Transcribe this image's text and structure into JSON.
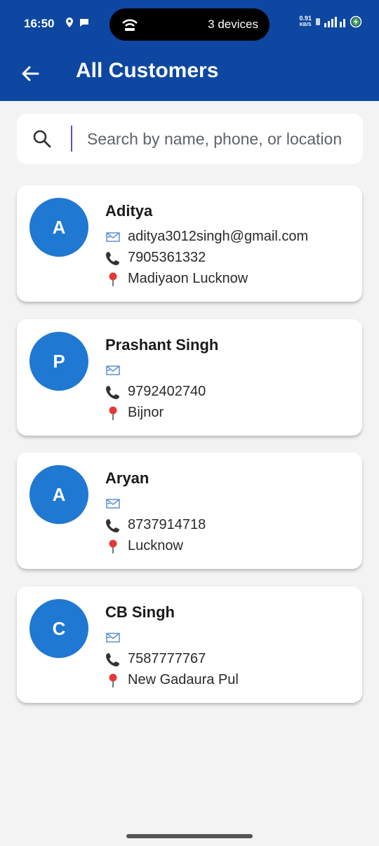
{
  "status_bar": {
    "time": "16:50",
    "pill_text": "3 devices",
    "net_speed_value": "0.91",
    "net_speed_unit": "KB/S",
    "bg_color": "#0d47a1"
  },
  "app_bar": {
    "title": "All Customers",
    "back_icon": "arrow-back-icon"
  },
  "search": {
    "placeholder": "Search by name, phone, or location",
    "value": "",
    "icon": "search-icon"
  },
  "customers": [
    {
      "initial": "A",
      "name": "Aditya",
      "email": "aditya3012singh@gmail.com",
      "phone": "7905361332",
      "location": "Madiyaon Lucknow"
    },
    {
      "initial": "P",
      "name": "Prashant Singh",
      "email": "",
      "phone": "9792402740",
      "location": "Bijnor"
    },
    {
      "initial": "A",
      "name": "Aryan",
      "email": "",
      "phone": "8737914718",
      "location": "Lucknow"
    },
    {
      "initial": "C",
      "name": "CB Singh",
      "email": "",
      "phone": "7587777767",
      "location": "New Gadaura Pul"
    }
  ],
  "colors": {
    "app_bar": "#0d47a1",
    "avatar": "#1f78d1",
    "background": "#f3f3f3"
  }
}
